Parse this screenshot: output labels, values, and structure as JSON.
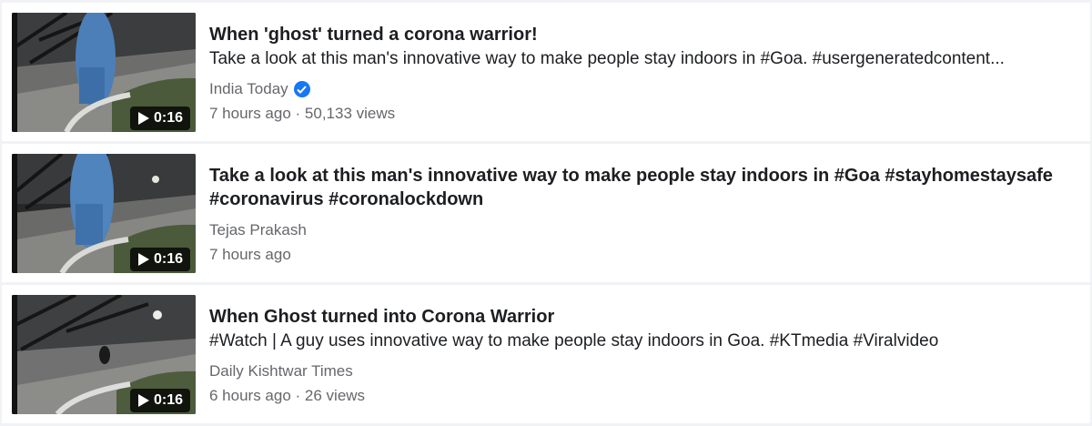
{
  "results": [
    {
      "title": "When 'ghost' turned a corona warrior!",
      "description": "Take a look at this man's innovative way to make people stay indoors in #Goa. #usergeneratedcontent...",
      "source": "India Today",
      "verified": true,
      "time": "7 hours ago",
      "views": "50,133 views",
      "duration": "0:16"
    },
    {
      "title": "Take a look at this man's innovative way to make people stay indoors in #Goa #stayhomestaysafe #coronavirus #coronalockdown",
      "description": "",
      "source": "Tejas Prakash",
      "verified": false,
      "time": "7 hours ago",
      "views": "",
      "duration": "0:16"
    },
    {
      "title": "When Ghost turned into Corona Warrior",
      "description": "#Watch | A guy uses innovative way to make people stay indoors in Goa. #KTmedia #Viralvideo",
      "source": "Daily Kishtwar Times",
      "verified": false,
      "time": "6 hours ago",
      "views": "26 views",
      "duration": "0:16"
    }
  ],
  "colors": {
    "background": "#f0f2f5",
    "title": "#1c1e21",
    "secondary": "#65676b",
    "verified_badge": "#1877f2"
  },
  "icons": {
    "play": "play-icon",
    "verified": "verified-badge-icon"
  },
  "separator": " · "
}
